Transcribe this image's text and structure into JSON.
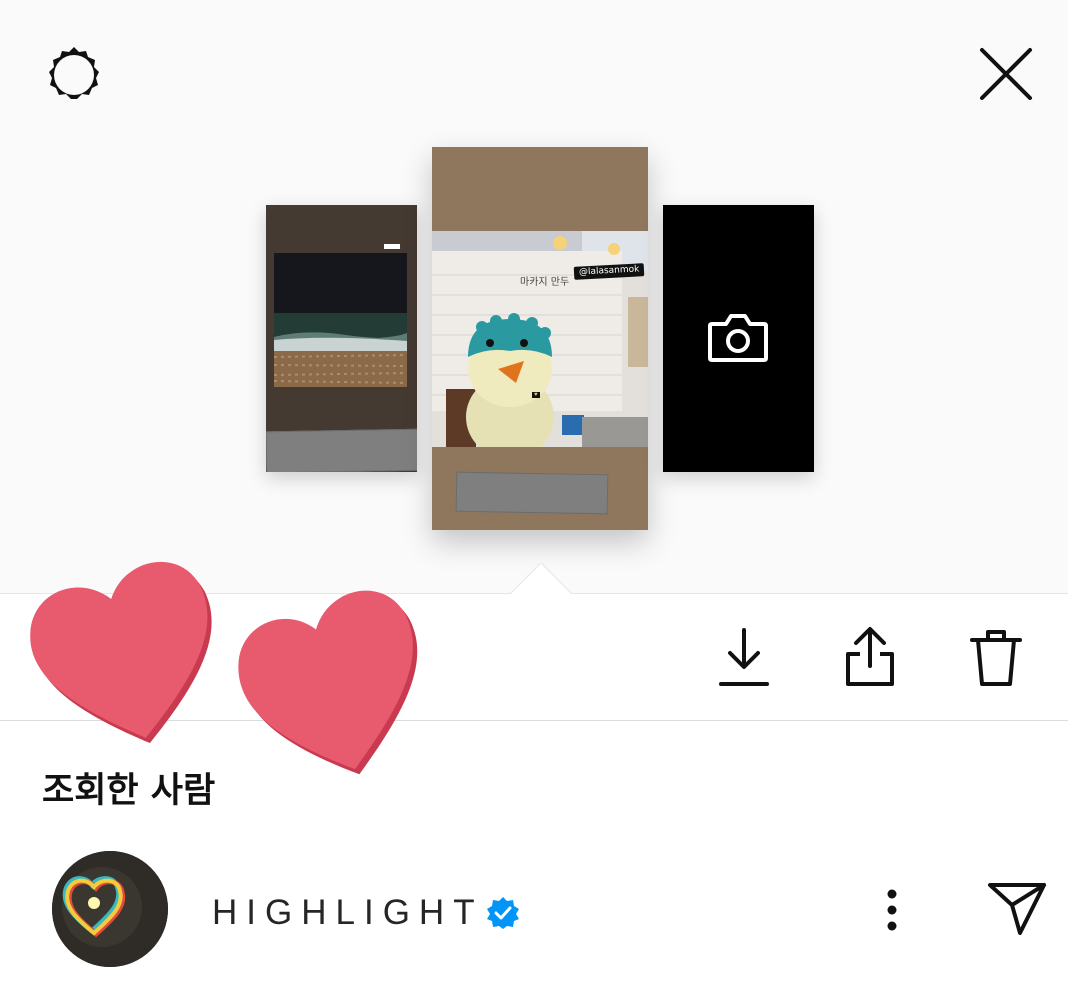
{
  "header": {
    "settings_icon": "settings-gear-icon",
    "close_icon": "close-x-icon"
  },
  "stories": [
    {
      "id": "left",
      "kind": "night-beach-photo"
    },
    {
      "id": "center",
      "kind": "duck-plush-photo",
      "mention_sticker": "@lalasanmok"
    },
    {
      "id": "right",
      "kind": "add-story-camera",
      "icon": "camera-icon"
    }
  ],
  "actions": {
    "download_icon": "download-icon",
    "share_icon": "share-icon",
    "delete_icon": "trash-icon"
  },
  "viewers": {
    "title": "조회한 사람",
    "items": [
      {
        "name": "HIGHLIGHT",
        "verified": true,
        "more_icon": "more-vertical-icon",
        "send_icon": "send-icon"
      }
    ]
  },
  "colors": {
    "heart": "#e85a6e",
    "verified_blue": "#0095f6",
    "center_bg": "#8e775c"
  }
}
